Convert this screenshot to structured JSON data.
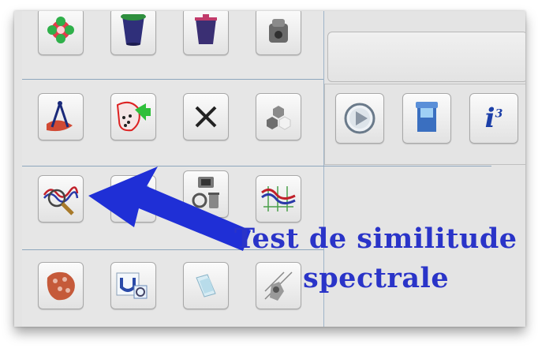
{
  "annotation": {
    "line1": "Test de similitude",
    "line2": "spectrale",
    "color": "#2a34c8"
  },
  "toolbar": {
    "rows": [
      [
        "flower-tool-icon",
        "bucket-tool-icon",
        "gift-bucket-tool-icon",
        "mixer-tool-icon"
      ],
      [
        "compass-measure-icon",
        "region-select-icon",
        "close-x-icon",
        "hexagon-cluster-icon"
      ],
      [
        "spectral-similarity-search-icon",
        "cups-compare-icon",
        "device-recycle-icon",
        "spectra-overlay-icon"
      ],
      [
        "map-cells-icon",
        "magnet-zoom-icon",
        "glass-panel-icon",
        "tool-diagram-icon"
      ]
    ],
    "right_buttons": [
      "play-icon",
      "database-icon",
      "info-icon"
    ],
    "info_label": "i",
    "info_sup": "3"
  }
}
